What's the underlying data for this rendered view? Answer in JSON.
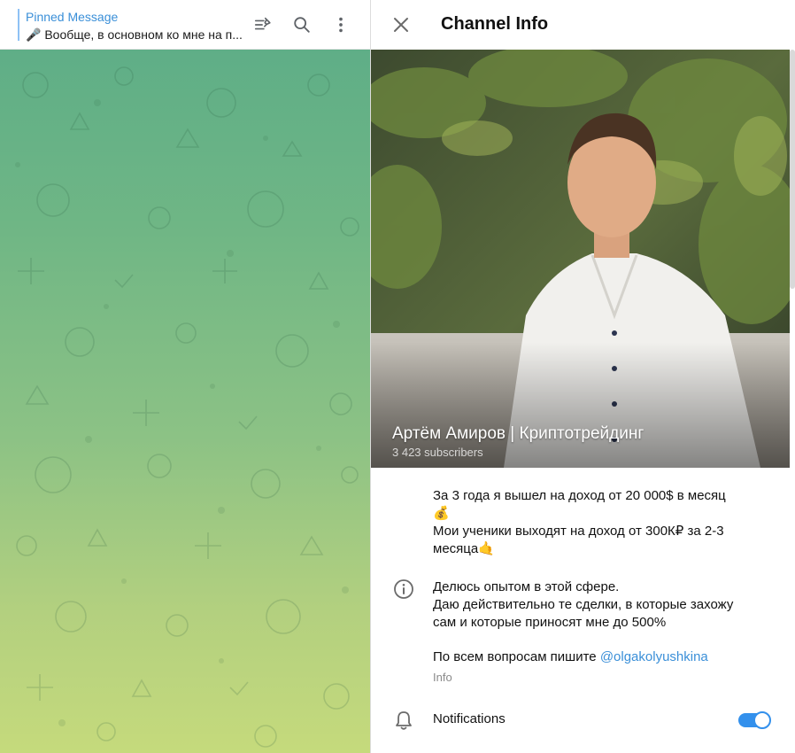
{
  "pinned": {
    "title": "Pinned Message",
    "text": "🎤 Вообще, в основном ко мне на п..."
  },
  "toolbar": {
    "icons": [
      "pin-list-icon",
      "search-icon",
      "more-vertical-icon"
    ]
  },
  "panel": {
    "title": "Channel Info",
    "close_icon": "close-icon"
  },
  "channel": {
    "name": "Артём Амиров | Криптотрейдинг",
    "subscribers": "3 423 subscribers",
    "description_line1": "За 3 года я вышел на доход от 20 000$ в месяц",
    "description_emoji1": "💰",
    "description_line2": "Мои ученики выходят на доход от 300К₽ за 2-3",
    "description_line3": "месяца🤙",
    "about_line1": "Делюсь опытом в этой сфере.",
    "about_line2": "Даю действительно те сделки, в которые захожу",
    "about_line3": "сам и которые приносят мне до 500%",
    "contact_prefix": "По всем вопросам пишите ",
    "contact_link": "@olgakolyushkina",
    "info_label": "Info"
  },
  "notifications": {
    "label": "Notifications",
    "enabled": true
  },
  "colors": {
    "accent": "#3390ec",
    "link": "#3a8fd8"
  }
}
